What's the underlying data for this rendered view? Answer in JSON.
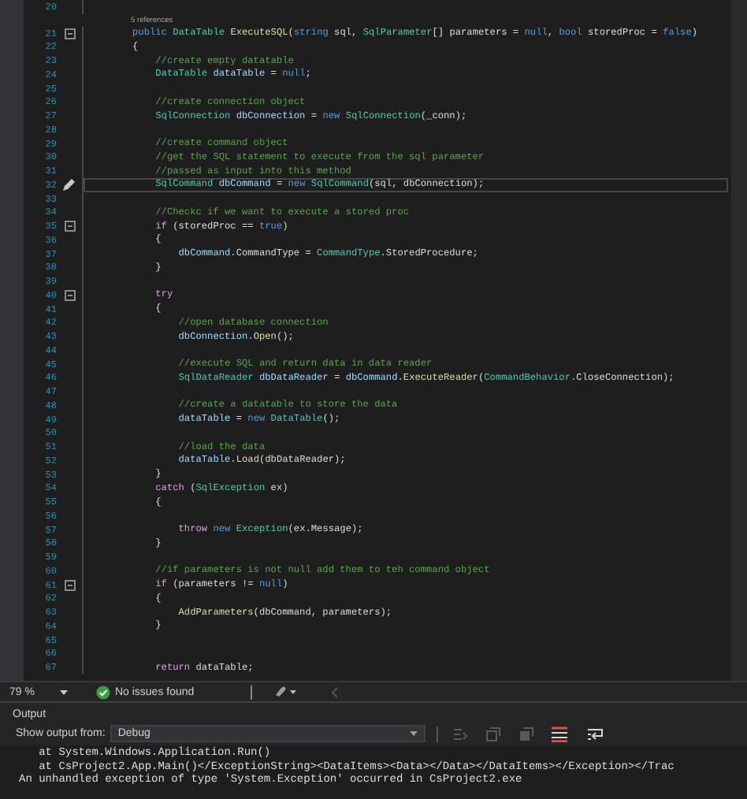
{
  "editor": {
    "codelens": "5 references",
    "lines": [
      {
        "number": "20",
        "foldable": false,
        "current": false
      },
      {
        "number": "21",
        "foldable": true,
        "current": false,
        "tokens": [
          {
            "kind": "keyword",
            "text": "public"
          },
          {
            "kind": "type",
            "text": " DataTable"
          },
          {
            "kind": "method",
            "text": " ExecuteSQL"
          },
          {
            "kind": "plain",
            "text": "("
          },
          {
            "kind": "keyword",
            "text": "string"
          },
          {
            "kind": "plain",
            "text": " sql, "
          },
          {
            "kind": "type",
            "text": "SqlParameter"
          },
          {
            "kind": "plain",
            "text": "[] parameters = "
          },
          {
            "kind": "keyword",
            "text": "null"
          },
          {
            "kind": "plain",
            "text": ", "
          },
          {
            "kind": "keyword",
            "text": "bool"
          },
          {
            "kind": "plain",
            "text": " storedProc = "
          },
          {
            "kind": "keyword",
            "text": "false"
          },
          {
            "kind": "plain",
            "text": ")"
          }
        ]
      },
      {
        "number": "22",
        "foldable": false,
        "current": false,
        "tokens": [
          {
            "kind": "plain",
            "text": "{"
          }
        ]
      },
      {
        "number": "23",
        "foldable": false,
        "current": false,
        "tokens": [
          {
            "kind": "comment",
            "text": "    //create empty datatable"
          }
        ]
      },
      {
        "number": "24",
        "foldable": false,
        "current": false,
        "tokens": [
          {
            "kind": "type",
            "text": "    DataTable"
          },
          {
            "kind": "name",
            "text": " dataTable"
          },
          {
            "kind": "plain",
            "text": " ="
          },
          {
            "kind": "keyword",
            "text": " null"
          },
          {
            "kind": "plain",
            "text": ";"
          }
        ]
      },
      {
        "number": "25",
        "foldable": false,
        "current": false
      },
      {
        "number": "26",
        "foldable": false,
        "current": false,
        "tokens": [
          {
            "kind": "comment",
            "text": "    //create connection object"
          }
        ]
      },
      {
        "number": "27",
        "foldable": false,
        "current": false,
        "tokens": [
          {
            "kind": "type",
            "text": "    SqlConnection"
          },
          {
            "kind": "name",
            "text": " dbConnection"
          },
          {
            "kind": "plain",
            "text": " ="
          },
          {
            "kind": "keyword",
            "text": " new"
          },
          {
            "kind": "type",
            "text": " SqlConnection"
          },
          {
            "kind": "plain",
            "text": "(_conn);"
          }
        ]
      },
      {
        "number": "28",
        "foldable": false,
        "current": false
      },
      {
        "number": "29",
        "foldable": false,
        "current": false,
        "tokens": [
          {
            "kind": "comment",
            "text": "    //create command object"
          }
        ]
      },
      {
        "number": "30",
        "foldable": false,
        "current": false,
        "tokens": [
          {
            "kind": "comment",
            "text": "    //get the SQL statement to execute from the sql parameter"
          }
        ]
      },
      {
        "number": "31",
        "foldable": false,
        "current": false,
        "tokens": [
          {
            "kind": "comment",
            "text": "    //passed as input into this method"
          }
        ]
      },
      {
        "number": "32",
        "foldable": false,
        "current": true,
        "tokens": [
          {
            "kind": "type",
            "text": "    SqlCommand"
          },
          {
            "kind": "name",
            "text": " dbCommand"
          },
          {
            "kind": "plain",
            "text": " ="
          },
          {
            "kind": "keyword",
            "text": " new"
          },
          {
            "kind": "type",
            "text": " SqlCommand"
          },
          {
            "kind": "plain",
            "text": "(sql, dbConnection);"
          }
        ]
      },
      {
        "number": "33",
        "foldable": false,
        "current": false
      },
      {
        "number": "34",
        "foldable": false,
        "current": false,
        "tokens": [
          {
            "kind": "comment",
            "text": "    //Checkc if we want to execute a stored proc"
          }
        ]
      },
      {
        "number": "35",
        "foldable": true,
        "current": false,
        "tokens": [
          {
            "kind": "control",
            "text": "    if"
          },
          {
            "kind": "plain",
            "text": " (storedProc =="
          },
          {
            "kind": "keyword",
            "text": " true"
          },
          {
            "kind": "plain",
            "text": ")"
          }
        ]
      },
      {
        "number": "36",
        "foldable": false,
        "current": false,
        "tokens": [
          {
            "kind": "plain",
            "text": "    {"
          }
        ]
      },
      {
        "number": "37",
        "foldable": false,
        "current": false,
        "tokens": [
          {
            "kind": "name",
            "text": "        dbCommand"
          },
          {
            "kind": "plain",
            "text": ".CommandType ="
          },
          {
            "kind": "type",
            "text": " CommandType"
          },
          {
            "kind": "plain",
            "text": ".StoredProcedure;"
          }
        ]
      },
      {
        "number": "38",
        "foldable": false,
        "current": false,
        "tokens": [
          {
            "kind": "plain",
            "text": "    }"
          }
        ]
      },
      {
        "number": "39",
        "foldable": false,
        "current": false
      },
      {
        "number": "40",
        "foldable": true,
        "current": false,
        "tokens": [
          {
            "kind": "control",
            "text": "    try"
          }
        ]
      },
      {
        "number": "41",
        "foldable": false,
        "current": false,
        "tokens": [
          {
            "kind": "plain",
            "text": "    {"
          }
        ]
      },
      {
        "number": "42",
        "foldable": false,
        "current": false,
        "tokens": [
          {
            "kind": "comment",
            "text": "        //open database connection"
          }
        ]
      },
      {
        "number": "43",
        "foldable": false,
        "current": false,
        "tokens": [
          {
            "kind": "name",
            "text": "        dbConnection"
          },
          {
            "kind": "plain",
            "text": "."
          },
          {
            "kind": "method",
            "text": "Open"
          },
          {
            "kind": "plain",
            "text": "();"
          }
        ]
      },
      {
        "number": "44",
        "foldable": false,
        "current": false
      },
      {
        "number": "45",
        "foldable": false,
        "current": false,
        "tokens": [
          {
            "kind": "comment",
            "text": "        //execute SQL and return data in data reader"
          }
        ]
      },
      {
        "number": "46",
        "foldable": false,
        "current": false,
        "tokens": [
          {
            "kind": "type",
            "text": "        SqlDataReader"
          },
          {
            "kind": "name",
            "text": " dbDataReader"
          },
          {
            "kind": "plain",
            "text": " ="
          },
          {
            "kind": "name",
            "text": " dbCommand"
          },
          {
            "kind": "plain",
            "text": "."
          },
          {
            "kind": "method",
            "text": "ExecuteReader"
          },
          {
            "kind": "plain",
            "text": "("
          },
          {
            "kind": "type",
            "text": "CommandBehavior"
          },
          {
            "kind": "plain",
            "text": ".CloseConnection);"
          }
        ]
      },
      {
        "number": "47",
        "foldable": false,
        "current": false
      },
      {
        "number": "48",
        "foldable": false,
        "current": false,
        "tokens": [
          {
            "kind": "comment",
            "text": "        //create a datatable to store the data"
          }
        ]
      },
      {
        "number": "49",
        "foldable": false,
        "current": false,
        "tokens": [
          {
            "kind": "name",
            "text": "        dataTable"
          },
          {
            "kind": "plain",
            "text": " ="
          },
          {
            "kind": "keyword",
            "text": " new"
          },
          {
            "kind": "type",
            "text": " DataTable"
          },
          {
            "kind": "plain",
            "text": "();"
          }
        ]
      },
      {
        "number": "50",
        "foldable": false,
        "current": false
      },
      {
        "number": "51",
        "foldable": false,
        "current": false,
        "tokens": [
          {
            "kind": "comment",
            "text": "        //load the data"
          }
        ]
      },
      {
        "number": "52",
        "foldable": false,
        "current": false,
        "tokens": [
          {
            "kind": "name",
            "text": "        dataTable"
          },
          {
            "kind": "plain",
            "text": "."
          },
          {
            "kind": "method",
            "text": "Load"
          },
          {
            "kind": "plain",
            "text": "(dbDataReader);"
          }
        ]
      },
      {
        "number": "53",
        "foldable": false,
        "current": false,
        "tokens": [
          {
            "kind": "plain",
            "text": "    }"
          }
        ]
      },
      {
        "number": "54",
        "foldable": false,
        "current": false,
        "tokens": [
          {
            "kind": "control",
            "text": "    catch"
          },
          {
            "kind": "plain",
            "text": " ("
          },
          {
            "kind": "type",
            "text": "SqlException"
          },
          {
            "kind": "plain",
            "text": " ex)"
          }
        ]
      },
      {
        "number": "55",
        "foldable": false,
        "current": false,
        "tokens": [
          {
            "kind": "plain",
            "text": "    {"
          }
        ]
      },
      {
        "number": "56",
        "foldable": false,
        "current": false
      },
      {
        "number": "57",
        "foldable": false,
        "current": false,
        "tokens": [
          {
            "kind": "control",
            "text": "        throw"
          },
          {
            "kind": "keyword",
            "text": " new"
          },
          {
            "kind": "type",
            "text": " Exception"
          },
          {
            "kind": "plain",
            "text": "(ex.Message);"
          }
        ]
      },
      {
        "number": "58",
        "foldable": false,
        "current": false,
        "tokens": [
          {
            "kind": "plain",
            "text": "    }"
          }
        ]
      },
      {
        "number": "59",
        "foldable": false,
        "current": false
      },
      {
        "number": "60",
        "foldable": false,
        "current": false,
        "tokens": [
          {
            "kind": "comment",
            "text": "    //if parameters is not null add them to teh command object"
          }
        ]
      },
      {
        "number": "61",
        "foldable": true,
        "current": false,
        "tokens": [
          {
            "kind": "control",
            "text": "    if"
          },
          {
            "kind": "plain",
            "text": " (parameters !="
          },
          {
            "kind": "keyword",
            "text": " null"
          },
          {
            "kind": "plain",
            "text": ")"
          }
        ]
      },
      {
        "number": "62",
        "foldable": false,
        "current": false,
        "tokens": [
          {
            "kind": "plain",
            "text": "    {"
          }
        ]
      },
      {
        "number": "63",
        "foldable": false,
        "current": false,
        "tokens": [
          {
            "kind": "method",
            "text": "        AddParameters"
          },
          {
            "kind": "plain",
            "text": "(dbCommand, parameters);"
          }
        ]
      },
      {
        "number": "64",
        "foldable": false,
        "current": false,
        "tokens": [
          {
            "kind": "plain",
            "text": "    }"
          }
        ]
      },
      {
        "number": "65",
        "foldable": false,
        "current": false
      },
      {
        "number": "66",
        "foldable": false,
        "current": false
      },
      {
        "number": "67",
        "foldable": false,
        "current": false,
        "tokens": [
          {
            "kind": "control",
            "text": "    return"
          },
          {
            "kind": "plain",
            "text": " dataTable;"
          }
        ]
      }
    ]
  },
  "status_bar": {
    "zoom": "79 %",
    "issues": "No issues found"
  },
  "output": {
    "title": "Output",
    "source_label": "Show output from:",
    "source": "Debug",
    "toolbar_buttons": [
      {
        "disabled": true
      },
      {
        "disabled": true
      },
      {
        "disabled": true
      },
      {
        "disabled": false
      },
      {
        "disabled": false
      }
    ],
    "lines": [
      "   at System.Windows.Application.Run()",
      "   at CsProject2.App.Main()</ExceptionString><DataItems><Data></Data></DataItems></Exception></Trac",
      "An unhandled exception of type 'System.Exception' occurred in CsProject2.exe"
    ]
  }
}
